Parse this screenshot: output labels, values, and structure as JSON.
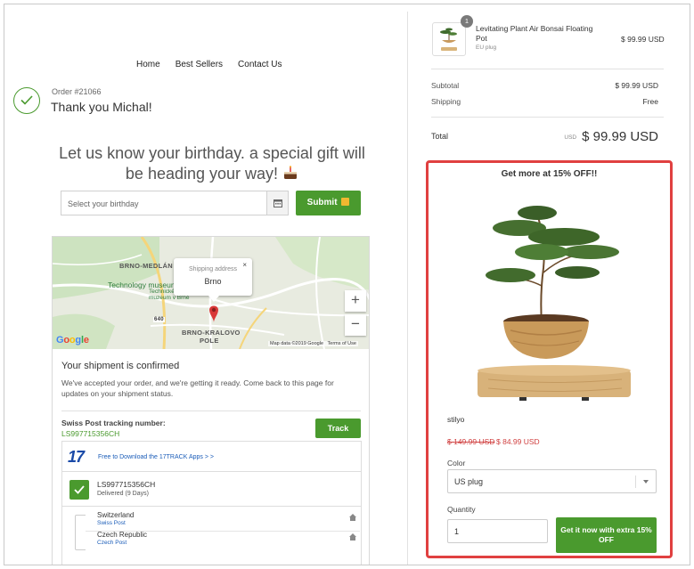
{
  "nav": {
    "home": "Home",
    "best_sellers": "Best Sellers",
    "contact_us": "Contact Us"
  },
  "order": {
    "number": "Order #21066",
    "thanks": "Thank you Michal!"
  },
  "birthday": {
    "headline": "Let us know your birthday. a special gift will be heading your way!",
    "placeholder": "Select your birthday",
    "submit_label": "Submit"
  },
  "map": {
    "popup_label": "Shipping address",
    "popup_value": "Brno",
    "popup_close": "×",
    "labels": [
      "BRNO-MEDLÁN",
      "BRNO-KRALOVO",
      "POLE"
    ],
    "poi_1": "Technology museum",
    "poi_2": "Technické",
    "poi_3": "muzeum v Brně",
    "road_label": "640",
    "zoom_in": "+",
    "zoom_out": "−",
    "google": "Google",
    "map_data": "Map data ©2019 Google",
    "terms": "Terms of Use"
  },
  "shipment": {
    "title": "Your shipment is confirmed",
    "description": "We've accepted your order, and we're getting it ready. Come back to this page for updates on your shipment status.",
    "tracking_label": "Swiss Post tracking number:",
    "tracking_number": "LS997715356CH",
    "track_button": "Track",
    "app_logo": "17",
    "app_link": "Free to Download the 17TRACK Apps  >  >",
    "status_number": "LS997715356CH",
    "status_sub": "Delivered (9 Days)",
    "route": [
      {
        "country": "Switzerland",
        "carrier": "Swiss Post"
      },
      {
        "country": "Czech Republic",
        "carrier": "Czech Post"
      }
    ]
  },
  "cart": {
    "quantity": "1",
    "product_name": "Levitating Plant Air Bonsai Floating Pot",
    "variant": "EU plug",
    "price": "$ 99.99 USD",
    "subtotal_label": "Subtotal",
    "subtotal_value": "$ 99.99 USD",
    "shipping_label": "Shipping",
    "shipping_value": "Free",
    "total_label": "Total",
    "total_currency": "USD",
    "total_value": "$ 99.99 USD"
  },
  "upsell": {
    "title": "Get more at 15% OFF!!",
    "brand": "stilyo",
    "old_price": "$ 149.99 USD",
    "new_price": "$ 84.99 USD",
    "color_label": "Color",
    "color_value": "US plug",
    "quantity_label": "Quantity",
    "quantity_value": "1",
    "cta": "Get it now with extra 15% OFF"
  },
  "colors": {
    "accent_green": "#4a9a2e",
    "highlight_red": "#e04040",
    "link_blue": "#1a5cb8"
  }
}
